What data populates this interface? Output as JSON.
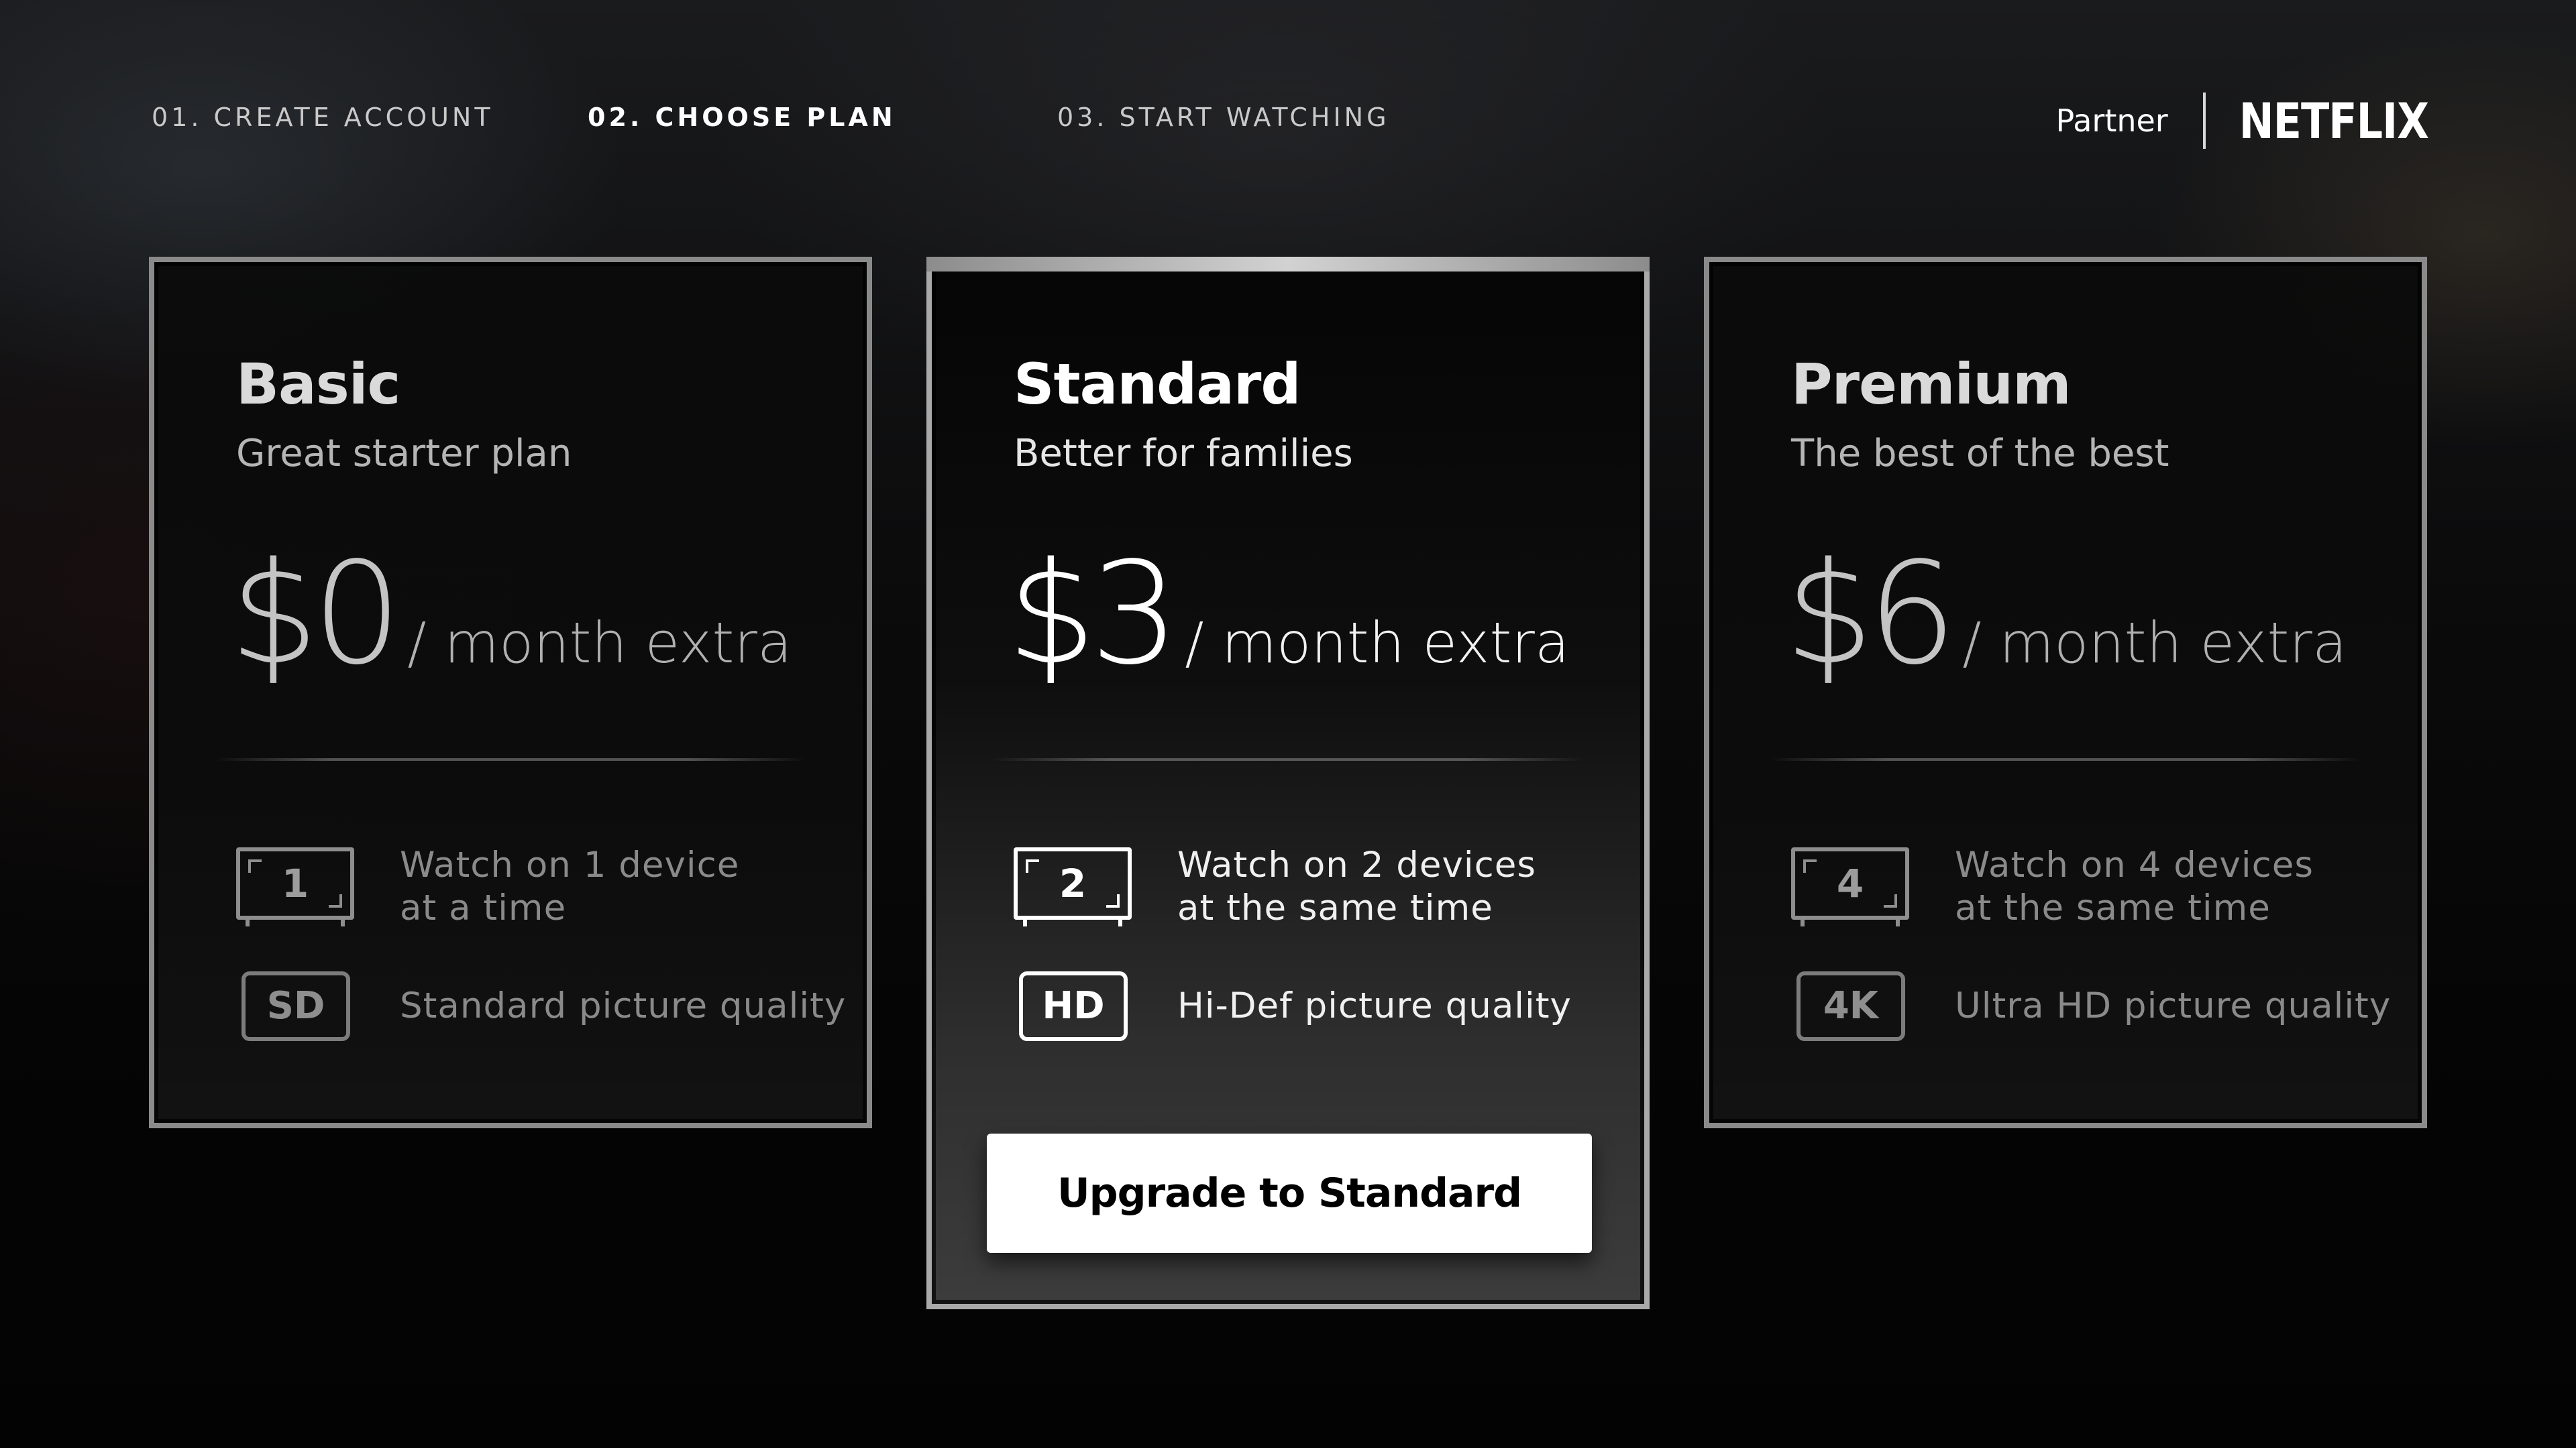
{
  "header": {
    "steps": [
      {
        "label": "01. CREATE ACCOUNT",
        "state": "complete"
      },
      {
        "label": "02. CHOOSE PLAN",
        "state": "current"
      },
      {
        "label": "03. START WATCHING",
        "state": "upcoming"
      }
    ],
    "partner_label": "Partner",
    "brand_logo_text": "NETFLIX"
  },
  "plans": [
    {
      "name": "Basic",
      "tagline": "Great starter plan",
      "price": "$0",
      "price_suffix": "/ month extra",
      "device_count": "1",
      "devices_line1": "Watch on 1 device",
      "devices_line2": "at a time",
      "quality_badge": "SD",
      "quality_text": "Standard picture quality",
      "icons": [
        "tv-icon",
        "sd-badge-icon"
      ],
      "state": "dimmed"
    },
    {
      "name": "Standard",
      "tagline": "Better for families",
      "price": "$3",
      "price_suffix": "/ month extra",
      "device_count": "2",
      "devices_line1": "Watch on 2 devices",
      "devices_line2": "at the same time",
      "quality_badge": "HD",
      "quality_text": "Hi-Def picture quality",
      "cta_label": "Upgrade to Standard",
      "icons": [
        "tv-icon",
        "hd-badge-icon"
      ],
      "state": "focused"
    },
    {
      "name": "Premium",
      "tagline": "The best of the best",
      "price": "$6",
      "price_suffix": "/ month extra",
      "device_count": "4",
      "devices_line1": "Watch on 4 devices",
      "devices_line2": "at the same time",
      "quality_badge": "4K",
      "quality_text": "Ultra HD picture quality",
      "icons": [
        "tv-icon",
        "4k-badge-icon"
      ],
      "state": "dimmed"
    }
  ],
  "colors": {
    "background": "#0a0a0a",
    "focused_border": "#a9a9a9",
    "dim_border": "#8a8a8a",
    "cta_background": "#ffffff",
    "cta_text": "#000000"
  }
}
